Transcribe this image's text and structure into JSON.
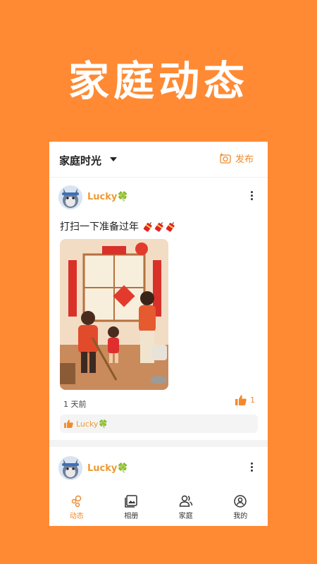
{
  "banner": {
    "title": "家庭动态"
  },
  "header": {
    "group_title": "家庭时光",
    "publish_label": "发布"
  },
  "posts": [
    {
      "username": "Lucky🍀",
      "text": "打扫一下准备过年",
      "time": "1 天前",
      "like_count": "1",
      "liked_by": "Lucky🍀"
    },
    {
      "username": "Lucky🍀"
    }
  ],
  "tabs": [
    {
      "label": "动态",
      "icon": "moments-icon",
      "active": true
    },
    {
      "label": "相册",
      "icon": "album-icon",
      "active": false
    },
    {
      "label": "家庭",
      "icon": "family-icon",
      "active": false
    },
    {
      "label": "我的",
      "icon": "profile-icon",
      "active": false
    }
  ],
  "colors": {
    "background": "#FF8A33",
    "accent": "#F28A2C",
    "username": "#EE9A33"
  }
}
